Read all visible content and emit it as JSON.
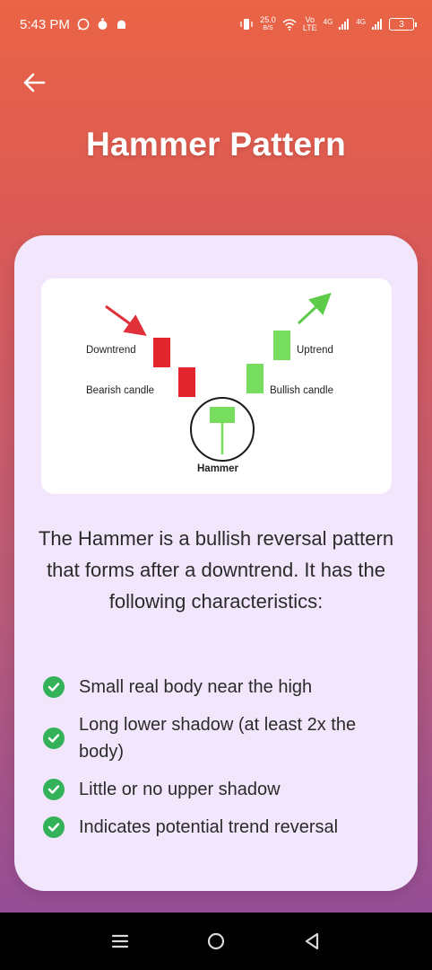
{
  "status_bar": {
    "time": "5:43 PM",
    "speed_value": "25.0",
    "speed_unit": "B/S",
    "volte_top": "Vo",
    "volte_bottom": "LTE",
    "net1": "4G",
    "net2": "4G",
    "battery": "3",
    "icons": [
      "whatsapp-icon",
      "stopwatch-icon",
      "android-icon",
      "vibrate-icon",
      "wifi-icon",
      "signal-icon",
      "signal-icon",
      "battery-icon"
    ]
  },
  "header": {
    "back_icon": "arrow-left-icon",
    "title": "Hammer Pattern"
  },
  "illustration": {
    "labels": {
      "downtrend": "Downtrend",
      "bearish": "Bearish candle",
      "uptrend": "Uptrend",
      "bullish": "Bullish candle",
      "hammer": "Hammer"
    },
    "colors": {
      "bearish": "#e3262e",
      "bullish": "#77dd5f",
      "arrow_down": "#e0303a",
      "arrow_up": "#5ccc4a"
    }
  },
  "description": "The Hammer is a bullish reversal pattern that forms after a downtrend. It has the following characteristics:",
  "characteristics": [
    "Small real body near the high",
    "Long lower shadow (at least 2x the body)",
    "Little or no upper shadow",
    "Indicates potential trend reversal"
  ],
  "colors": {
    "check": "#34b25a",
    "card_bg": "#f1e6fc"
  },
  "nav_bar": {
    "icons": [
      "recent-apps-icon",
      "home-icon",
      "back-triangle-icon"
    ]
  }
}
